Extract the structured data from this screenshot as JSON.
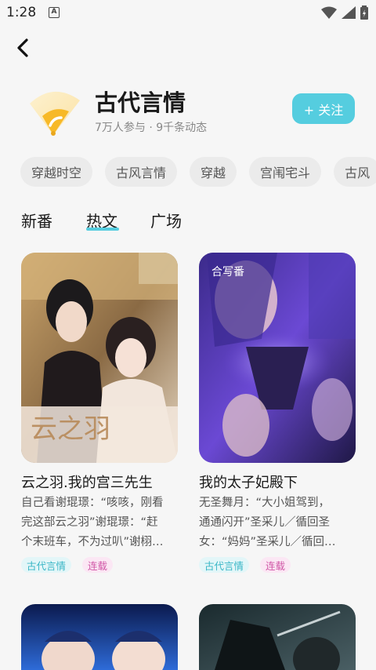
{
  "status_bar": {
    "time": "1:28",
    "notif_letter": "A"
  },
  "topic": {
    "title": "古代言情",
    "stats": "7万人参与 · 9千条动态",
    "follow_label": "+ 关注"
  },
  "tags": [
    "穿越时空",
    "古风言情",
    "穿越",
    "宫闱宅斗",
    "古风"
  ],
  "tabs": [
    "新番",
    "热文",
    "广场"
  ],
  "active_tab": "热文",
  "cards": [
    {
      "title": "云之羽.我的宫三先生",
      "desc": [
        "自己看谢琨璟：“咳咳，刚看",
        "完这部云之羽”谢琨璟：“赶",
        "个末班车，不为过叭”谢栩…"
      ],
      "chips": [
        "古代言情",
        "连载"
      ],
      "cover_text": "云之羽",
      "badge": ""
    },
    {
      "title": "我的太子妃殿下",
      "desc": [
        "无圣舞月：“大小姐驾到，",
        "通通闪开”圣采儿／循回圣",
        "女：“妈妈”圣采儿／循回…"
      ],
      "chips": [
        "古代言情",
        "连载"
      ],
      "cover_text": "",
      "badge": "合写番"
    }
  ],
  "colors": {
    "accent": "#55cddf",
    "chip_genre": "#39b6c6",
    "chip_serial": "#d055a6"
  },
  "icons": [
    "back-arrow-icon",
    "fan-icon",
    "wifi-icon",
    "signal-icon",
    "battery-icon"
  ]
}
